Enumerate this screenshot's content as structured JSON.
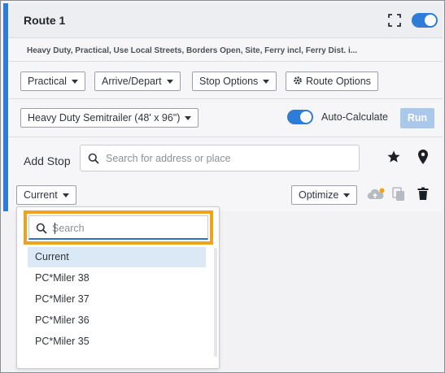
{
  "route": {
    "title": "Route 1",
    "summary": "Heavy Duty, Practical, Use Local Streets, Borders Open, Site, Ferry incl, Ferry Dist. i...",
    "enabled": true
  },
  "toolbar": {
    "routing_type": "Practical",
    "arrive_depart": "Arrive/Depart",
    "stop_options": "Stop Options",
    "route_options": "Route Options"
  },
  "vehicle": {
    "profile": "Heavy Duty Semitrailer (48' x 96\")",
    "auto_calculate_label": "Auto-Calculate",
    "auto_calculate_on": true,
    "run_label": "Run"
  },
  "add_stop": {
    "label": "Add Stop",
    "placeholder": "Search for address or place"
  },
  "stops_bar": {
    "version_label": "Current",
    "optimize_label": "Optimize"
  },
  "version_dropdown": {
    "search_placeholder": "Search",
    "items": [
      "Current",
      "PC*Miler 38",
      "PC*Miler 37",
      "PC*Miler 36",
      "PC*Miler 35"
    ],
    "selected": "Current"
  },
  "colors": {
    "accent": "#2f7bd8",
    "highlight": "#f0a31a",
    "selected_item": "#dbe9f7",
    "run_disabled": "#a9c8ea"
  }
}
